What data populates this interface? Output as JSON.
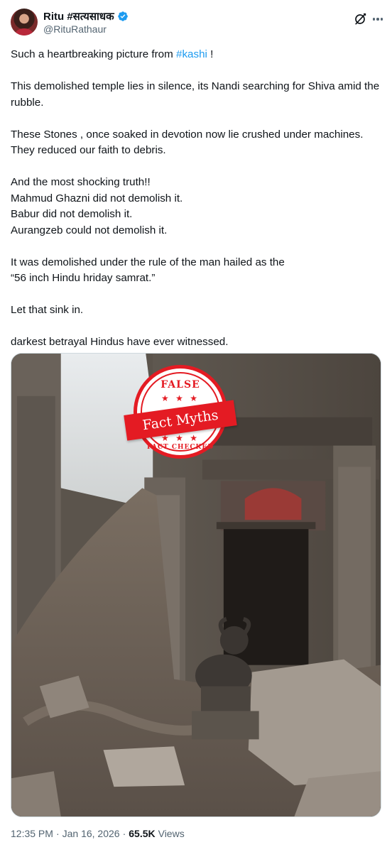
{
  "author": {
    "display_name": "Ritu #सत्यसाधक",
    "handle": "@RituRathaur",
    "verified": true,
    "avatar_icon": "profile-photo"
  },
  "actions": {
    "grok_icon": "grok-icon",
    "more_icon": "more-horizontal-icon"
  },
  "post": {
    "lines": [
      {
        "before": "Such a heartbreaking picture from ",
        "hashtag": "#kashi",
        "after": " !"
      },
      {
        "text": "This demolished temple  lies in silence, its Nandi searching for Shiva amid the rubble."
      },
      {
        "text": "These Stones , once soaked in devotion now lie crushed under machines. They reduced our faith to debris."
      },
      {
        "text": "And the most shocking truth!!"
      },
      {
        "text": "Mahmud Ghazni did not demolish it."
      },
      {
        "text": "Babur did not demolish it."
      },
      {
        "text": "Aurangzeb could not demolish it."
      },
      {
        "text": "It was demolished under the rule of the man hailed as the"
      },
      {
        "text": "“56 inch Hindu hriday samrat.”"
      },
      {
        "text": "Let that sink in."
      },
      {
        "text": "darkest betrayal Hindus have ever witnessed."
      }
    ]
  },
  "media": {
    "stamp": {
      "top_text": "FALSE",
      "banner_text": "Fact Myths",
      "bottom_text": "FACT CHECKED",
      "stars": "★ ★ ★",
      "color": "#e41b23"
    }
  },
  "footer": {
    "time": "12:35 PM",
    "separator": "·",
    "date": "Jan 16, 2026",
    "views_count": "65.5K",
    "views_label": "Views"
  },
  "colors": {
    "text": "#0f1419",
    "secondary": "#536471",
    "link": "#1d9bf0",
    "verified": "#1d9bf0"
  }
}
